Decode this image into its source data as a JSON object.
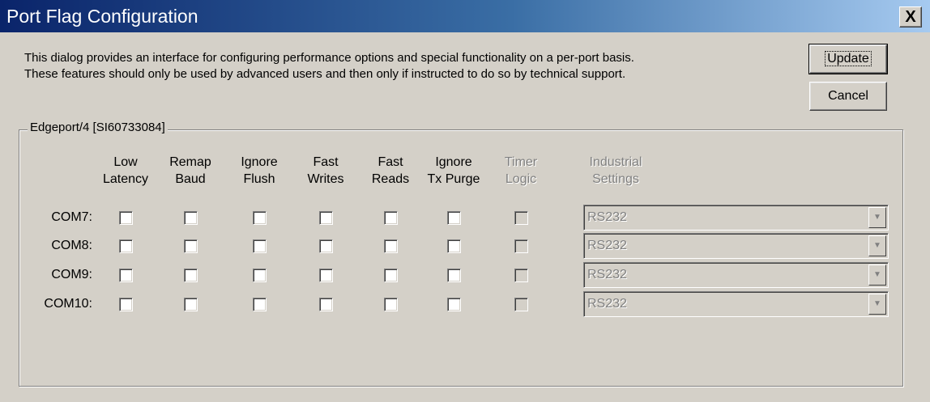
{
  "window": {
    "title": "Port Flag Configuration",
    "close_glyph": "X"
  },
  "description": {
    "line1": "This dialog provides an interface for configuring performance options and special functionality on a per-port basis.",
    "line2": "These features should only be used by advanced users and then only if instructed to do so by technical support."
  },
  "buttons": {
    "update": "Update",
    "cancel": "Cancel"
  },
  "group": {
    "label": "Edgeport/4 [SI60733084]"
  },
  "columns": [
    {
      "line1": "Low",
      "line2": "Latency",
      "enabled": true
    },
    {
      "line1": "Remap",
      "line2": "Baud",
      "enabled": true
    },
    {
      "line1": "Ignore",
      "line2": "Flush",
      "enabled": true
    },
    {
      "line1": "Fast",
      "line2": "Writes",
      "enabled": true
    },
    {
      "line1": "Fast",
      "line2": "Reads",
      "enabled": true
    },
    {
      "line1": "Ignore",
      "line2": "Tx Purge",
      "enabled": true
    },
    {
      "line1": "Timer",
      "line2": "Logic",
      "enabled": false
    },
    {
      "line1": "Industrial",
      "line2": "Settings",
      "enabled": false
    }
  ],
  "rows": [
    {
      "port": "COM7:",
      "checked": [
        false,
        false,
        false,
        false,
        false,
        false,
        false
      ],
      "industrial": "RS232"
    },
    {
      "port": "COM8:",
      "checked": [
        false,
        false,
        false,
        false,
        false,
        false,
        false
      ],
      "industrial": "RS232"
    },
    {
      "port": "COM9:",
      "checked": [
        false,
        false,
        false,
        false,
        false,
        false,
        false
      ],
      "industrial": "RS232"
    },
    {
      "port": "COM10:",
      "checked": [
        false,
        false,
        false,
        false,
        false,
        false,
        false
      ],
      "industrial": "RS232"
    }
  ],
  "icons": {
    "combo_arrow": "chevron-down-icon",
    "close": "close-icon"
  }
}
